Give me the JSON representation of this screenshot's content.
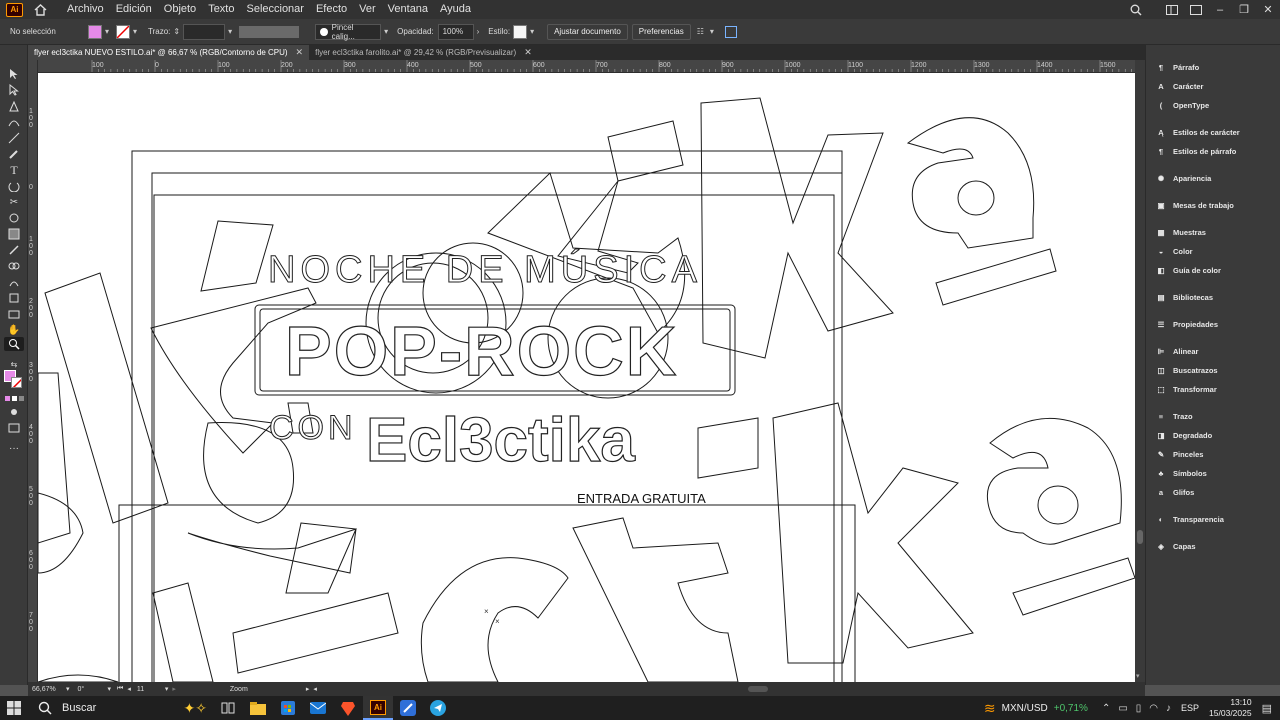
{
  "menubar": {
    "app_logo": "Ai",
    "menus": [
      "Archivo",
      "Edición",
      "Objeto",
      "Texto",
      "Seleccionar",
      "Efecto",
      "Ver",
      "Ventana",
      "Ayuda"
    ]
  },
  "control": {
    "selection": "No selección",
    "stroke_label": "Trazo:",
    "brush": "Pincel calig...",
    "opacity_label": "Opacidad:",
    "opacity_value": "100%",
    "style_label": "Estilo:",
    "fit_button": "Ajustar documento",
    "prefs_button": "Preferencias",
    "fill_color": "#e58ae8"
  },
  "tabs": [
    {
      "label": "flyer ecl3ctika NUEVO ESTILO.ai* @ 66,67 % (RGB/Contorno de CPU)",
      "active": true
    },
    {
      "label": "flyer ecl3ctika farolito.ai* @ 29,42 % (RGB/Previsualizar)",
      "active": false
    }
  ],
  "ruler": {
    "top_labels": [
      "100",
      "0",
      "100",
      "200",
      "300",
      "400",
      "500",
      "600",
      "700",
      "800",
      "900",
      "1000",
      "1100",
      "1200",
      "1300",
      "1400",
      "1500"
    ],
    "left_labels": [
      "1 0 0",
      "0",
      "1 0 0",
      "2 0 0",
      "3 0 0",
      "4 0 0",
      "5 0 0",
      "6 0 0",
      "7 0 0"
    ]
  },
  "artwork": {
    "line1": "NOCHE DE MÚSICA",
    "line2": "POP-ROCK",
    "line3_pre": "CON",
    "line3_logo": "Ecl3ctika",
    "line4": "ENTRADA GRATUITA",
    "background_word": "ctika"
  },
  "panels": [
    {
      "label": "Párrafo",
      "icon": "paragraph-icon"
    },
    {
      "label": "Carácter",
      "icon": "character-icon"
    },
    {
      "label": "OpenType",
      "icon": "opentype-icon"
    },
    {
      "label": "Estilos de carácter",
      "icon": "char-styles-icon"
    },
    {
      "label": "Estilos de párrafo",
      "icon": "para-styles-icon"
    },
    {
      "label": "Apariencia",
      "icon": "appearance-icon"
    },
    {
      "label": "Mesas de trabajo",
      "icon": "artboards-icon"
    },
    {
      "label": "Muestras",
      "icon": "swatches-icon"
    },
    {
      "label": "Color",
      "icon": "color-icon"
    },
    {
      "label": "Guía de color",
      "icon": "color-guide-icon"
    },
    {
      "label": "Bibliotecas",
      "icon": "libraries-icon"
    },
    {
      "label": "Propiedades",
      "icon": "properties-icon"
    },
    {
      "label": "Alinear",
      "icon": "align-icon"
    },
    {
      "label": "Buscatrazos",
      "icon": "pathfinder-icon"
    },
    {
      "label": "Transformar",
      "icon": "transform-icon"
    },
    {
      "label": "Trazo",
      "icon": "stroke-icon"
    },
    {
      "label": "Degradado",
      "icon": "gradient-icon"
    },
    {
      "label": "Pinceles",
      "icon": "brushes-icon"
    },
    {
      "label": "Símbolos",
      "icon": "symbols-icon"
    },
    {
      "label": "Glifos",
      "icon": "glyphs-icon"
    },
    {
      "label": "Transparencia",
      "icon": "transparency-icon"
    },
    {
      "label": "Capas",
      "icon": "layers-icon"
    }
  ],
  "status": {
    "zoom": "66,67%",
    "rotation": "0°",
    "artboard": "11",
    "tool": "Zoom"
  },
  "taskbar": {
    "search": "Buscar",
    "ticker": "MXN/USD",
    "ticker_change": "+0,71%",
    "lang": "ESP",
    "time": "13:10",
    "date": "15/03/2025"
  }
}
